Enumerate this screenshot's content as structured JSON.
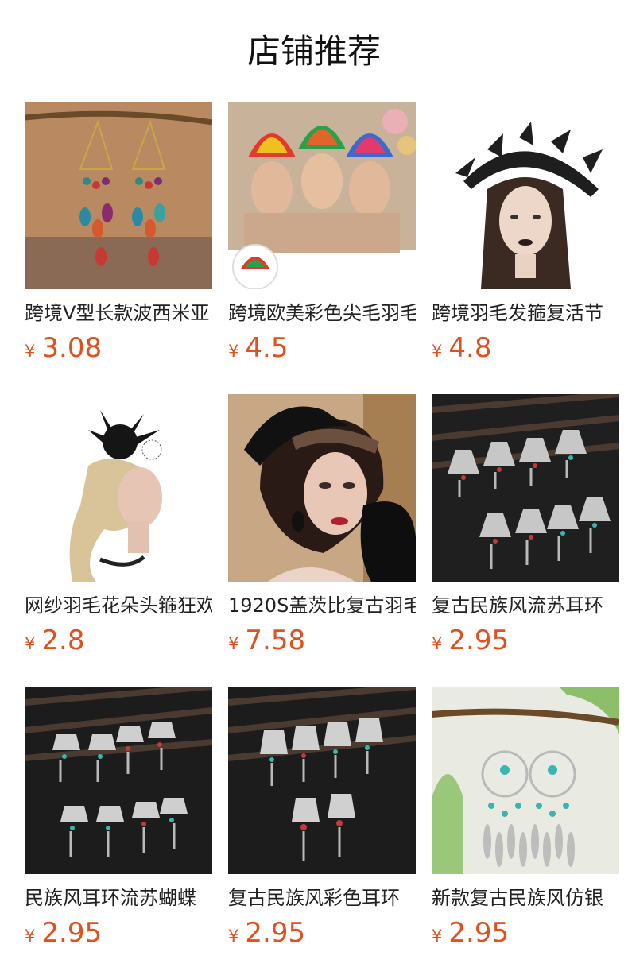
{
  "header": {
    "title": "店铺推荐"
  },
  "products": [
    {
      "name": "跨境V型长款波西米亚",
      "currency": "¥",
      "price": "3.08",
      "image": "feather-tassel-earrings"
    },
    {
      "name": "跨境欧美彩色尖毛羽毛",
      "currency": "¥",
      "price": "4.5",
      "image": "rainbow-feather-headband"
    },
    {
      "name": "跨境羽毛发箍复活节",
      "currency": "¥",
      "price": "4.8",
      "image": "black-feather-crown"
    },
    {
      "name": "网纱羽毛花朵头箍狂欢",
      "currency": "¥",
      "price": "2.8",
      "image": "black-flower-fascinator"
    },
    {
      "name": "1920S盖茨比复古羽毛",
      "currency": "¥",
      "price": "7.58",
      "image": "gatsby-feather-headpiece"
    },
    {
      "name": "复古民族风流苏耳环",
      "currency": "¥",
      "price": "2.95",
      "image": "ethnic-tassel-earrings"
    },
    {
      "name": "民族风耳环流苏蝴蝶",
      "currency": "¥",
      "price": "2.95",
      "image": "ethnic-butterfly-earrings"
    },
    {
      "name": "复古民族风彩色耳环",
      "currency": "¥",
      "price": "2.95",
      "image": "ethnic-colorful-earrings"
    },
    {
      "name": "新款复古民族风仿银",
      "currency": "¥",
      "price": "2.95",
      "image": "dreamcatcher-earrings"
    }
  ]
}
